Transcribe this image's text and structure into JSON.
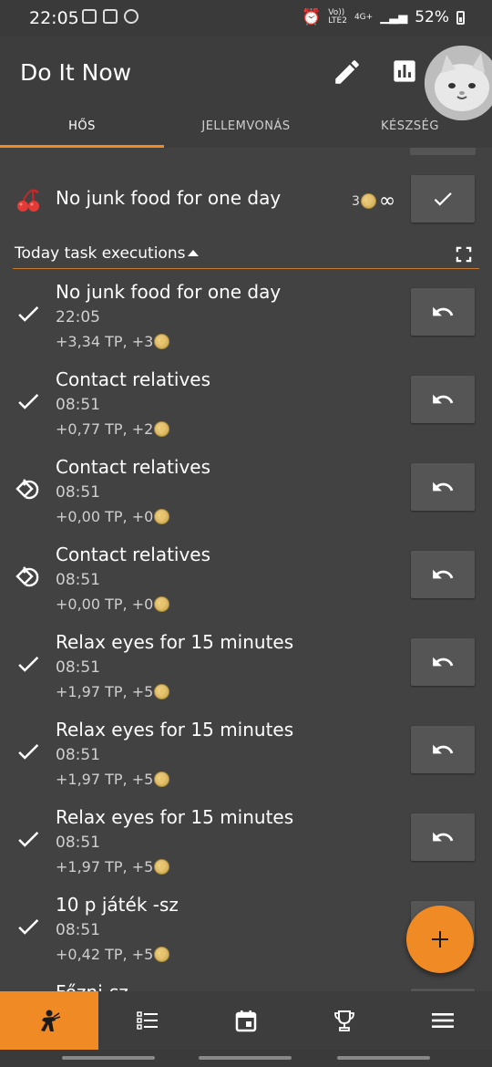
{
  "status_bar": {
    "time": "22:05",
    "network": [
      "Vo))",
      "LTE2",
      "4G+"
    ],
    "battery": "52%"
  },
  "app": {
    "title": "Do It Now"
  },
  "tabs": [
    {
      "label": "HŐS",
      "active": true
    },
    {
      "label": "JELLEMVONÁS",
      "active": false
    },
    {
      "label": "KÉSZSÉG",
      "active": false
    }
  ],
  "main_task": {
    "icon": "cherry-icon",
    "title": "No junk food for one day",
    "coin_count": "3",
    "repeat_icon": "∞",
    "action": "check-icon"
  },
  "section": {
    "label": "Today task executions"
  },
  "executions": [
    {
      "title": "No junk food for one day",
      "time": "22:05",
      "gain": "+3,34 TP, +3",
      "icon": "check-icon"
    },
    {
      "title": "Contact relatives",
      "time": "08:51",
      "gain": "+0,77 TP, +2",
      "icon": "check-icon"
    },
    {
      "title": "Contact relatives",
      "time": "08:51",
      "gain": "+0,00 TP, +0",
      "icon": "skip-icon"
    },
    {
      "title": "Contact relatives",
      "time": "08:51",
      "gain": "+0,00 TP, +0",
      "icon": "skip-icon"
    },
    {
      "title": "Relax eyes for 15 minutes",
      "time": "08:51",
      "gain": "+1,97 TP, +5",
      "icon": "check-icon"
    },
    {
      "title": "Relax eyes for 15 minutes",
      "time": "08:51",
      "gain": "+1,97 TP, +5",
      "icon": "check-icon"
    },
    {
      "title": "Relax eyes for 15 minutes",
      "time": "08:51",
      "gain": "+1,97 TP, +5",
      "icon": "check-icon"
    },
    {
      "title": "10 p játék -sz",
      "time": "08:51",
      "gain": "+0,42 TP, +5",
      "icon": "check-icon"
    },
    {
      "title": "Főzni-sz",
      "time": "",
      "gain": "",
      "icon": ""
    }
  ],
  "bottom_nav": [
    {
      "icon": "hero-icon",
      "active": true
    },
    {
      "icon": "list-icon",
      "active": false
    },
    {
      "icon": "calendar-icon",
      "active": false
    },
    {
      "icon": "trophy-icon",
      "active": false
    },
    {
      "icon": "menu-icon",
      "active": false
    }
  ],
  "colors": {
    "accent": "#f08a24",
    "background": "#424242",
    "appbar": "#3d3d3d",
    "button": "#555555"
  }
}
